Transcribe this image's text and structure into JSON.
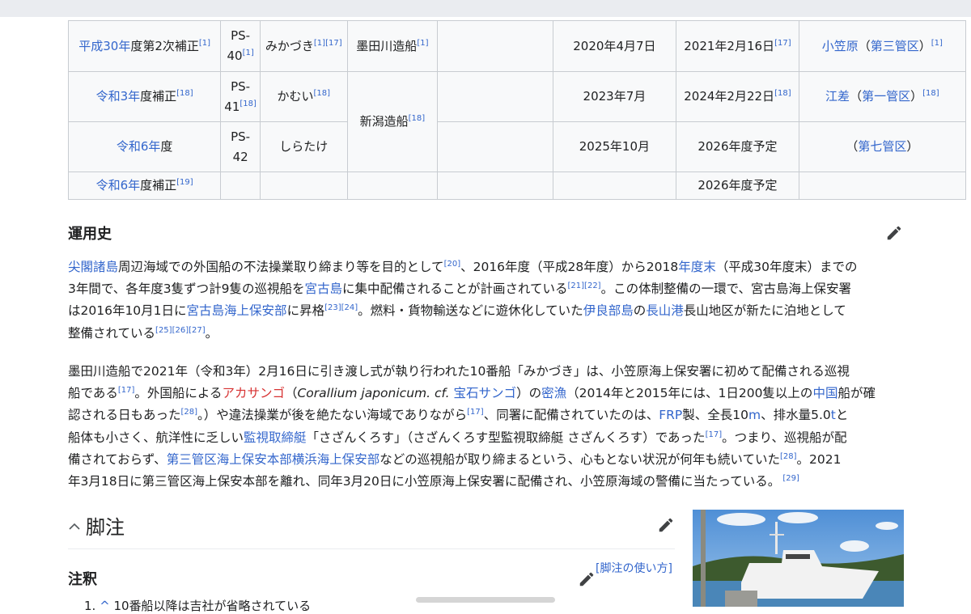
{
  "table": {
    "rows": [
      {
        "cells": [
          [
            {
              "k": "link",
              "t": "平成30年"
            },
            {
              "k": "text",
              "t": "度第2次補正"
            },
            {
              "k": "ref",
              "t": "[1]"
            }
          ],
          [
            {
              "k": "text",
              "t": "PS-"
            },
            {
              "k": "br"
            },
            {
              "k": "text",
              "t": "40"
            },
            {
              "k": "ref",
              "t": "[1]"
            }
          ],
          [
            {
              "k": "text",
              "t": "みかづき"
            },
            {
              "k": "ref",
              "t": "[1][17]"
            }
          ],
          [
            {
              "k": "text",
              "t": "墨田川造船"
            },
            {
              "k": "ref",
              "t": "[1]"
            }
          ],
          [],
          [
            {
              "k": "text",
              "t": "2020年4月7日"
            }
          ],
          [
            {
              "k": "text",
              "t": "2021年2月16日"
            },
            {
              "k": "ref",
              "t": "[17]"
            }
          ],
          [
            {
              "k": "link",
              "t": "小笠原"
            },
            {
              "k": "text",
              "t": "（"
            },
            {
              "k": "link",
              "t": "第三管区"
            },
            {
              "k": "text",
              "t": "）"
            },
            {
              "k": "ref",
              "t": "[1]"
            }
          ]
        ]
      },
      {
        "cells": [
          [
            {
              "k": "link",
              "t": "令和3年"
            },
            {
              "k": "text",
              "t": "度補正"
            },
            {
              "k": "ref",
              "t": "[18]"
            }
          ],
          [
            {
              "k": "text",
              "t": "PS-"
            },
            {
              "k": "br"
            },
            {
              "k": "text",
              "t": "41"
            },
            {
              "k": "ref",
              "t": "[18]"
            }
          ],
          [
            {
              "k": "text",
              "t": "かむい"
            },
            {
              "k": "ref",
              "t": "[18]"
            }
          ],
          [
            {
              "k": "text",
              "t": "新潟造船"
            },
            {
              "k": "ref",
              "t": "[18]"
            }
          ],
          [],
          [
            {
              "k": "text",
              "t": "2023年7月"
            }
          ],
          [
            {
              "k": "text",
              "t": "2024年2月22日"
            },
            {
              "k": "ref",
              "t": "[18]"
            }
          ],
          [
            {
              "k": "link",
              "t": "江差"
            },
            {
              "k": "text",
              "t": "（"
            },
            {
              "k": "link",
              "t": "第一管区"
            },
            {
              "k": "text",
              "t": "）"
            },
            {
              "k": "ref",
              "t": "[18]"
            }
          ]
        ]
      },
      {
        "cells": [
          [
            {
              "k": "link",
              "t": "令和6年"
            },
            {
              "k": "text",
              "t": "度"
            }
          ],
          [
            {
              "k": "text",
              "t": "PS-"
            },
            {
              "k": "br"
            },
            {
              "k": "text",
              "t": "42"
            }
          ],
          [
            {
              "k": "text",
              "t": "しらたけ"
            }
          ],
          [],
          [
            {
              "k": "text",
              "t": "2025年10月"
            }
          ],
          [
            {
              "k": "text",
              "t": "2026年度予定"
            }
          ],
          [
            {
              "k": "text",
              "t": "（"
            },
            {
              "k": "link",
              "t": "第七管区"
            },
            {
              "k": "text",
              "t": "）"
            }
          ]
        ]
      },
      {
        "cells": [
          [
            {
              "k": "link",
              "t": "令和6年"
            },
            {
              "k": "text",
              "t": "度補正"
            },
            {
              "k": "ref",
              "t": "[19]"
            }
          ],
          [],
          [],
          [],
          [],
          [],
          [
            {
              "k": "text",
              "t": "2026年度予定"
            }
          ],
          []
        ]
      }
    ]
  },
  "history": {
    "heading": "運用史",
    "paragraphs": [
      [
        {
          "k": "link",
          "t": "尖閣諸島"
        },
        {
          "k": "text",
          "t": "周辺海域での外国船の不法操業取り締まり等を目的として"
        },
        {
          "k": "ref",
          "t": "[20]"
        },
        {
          "k": "text",
          "t": "、2016年度（平成28年度）から2018"
        },
        {
          "k": "link",
          "t": "年度末"
        },
        {
          "k": "text",
          "t": "（平成30年度末）までの"
        },
        {
          "k": "br"
        },
        {
          "k": "text",
          "t": "3年間で、各年度3隻ずつ計9隻の巡視船を"
        },
        {
          "k": "link",
          "t": "宮古島"
        },
        {
          "k": "text",
          "t": "に集中配備されることが計画されている"
        },
        {
          "k": "ref",
          "t": "[21][22]"
        },
        {
          "k": "text",
          "t": "。この体制整備の一環で、宮古島海上保安署"
        },
        {
          "k": "br"
        },
        {
          "k": "text",
          "t": "は2016年10月1日に"
        },
        {
          "k": "link",
          "t": "宮古島海上保安部"
        },
        {
          "k": "text",
          "t": "に昇格"
        },
        {
          "k": "ref",
          "t": "[23][24]"
        },
        {
          "k": "text",
          "t": "。燃料・貨物輸送などに遊休化していた"
        },
        {
          "k": "link",
          "t": "伊良部島"
        },
        {
          "k": "text",
          "t": "の"
        },
        {
          "k": "link",
          "t": "長山港"
        },
        {
          "k": "text",
          "t": "長山地区が新たに泊地として"
        },
        {
          "k": "br"
        },
        {
          "k": "text",
          "t": "整備されている"
        },
        {
          "k": "ref",
          "t": "[25][26][27]"
        },
        {
          "k": "text",
          "t": "。"
        }
      ],
      [
        {
          "k": "text",
          "t": "墨田川造船で2021年（令和3年）2月16日に引き渡し式が執り行われた10番船「みかづき」は、小笠原海上保安署に初めて配備される巡視"
        },
        {
          "k": "br"
        },
        {
          "k": "text",
          "t": "船である"
        },
        {
          "k": "ref",
          "t": "[17]"
        },
        {
          "k": "text",
          "t": "。外国船による"
        },
        {
          "k": "red",
          "t": "アカサンゴ"
        },
        {
          "k": "text",
          "t": "（"
        },
        {
          "k": "italic",
          "t": "Corallium japonicum. cf."
        },
        {
          "k": "text",
          "t": " "
        },
        {
          "k": "link",
          "t": "宝石サンゴ"
        },
        {
          "k": "text",
          "t": "）の"
        },
        {
          "k": "link",
          "t": "密漁"
        },
        {
          "k": "text",
          "t": "（2014年と2015年には、1日200隻以上の"
        },
        {
          "k": "link",
          "t": "中国"
        },
        {
          "k": "text",
          "t": "船が確"
        },
        {
          "k": "br"
        },
        {
          "k": "text",
          "t": "認される日もあった"
        },
        {
          "k": "ref",
          "t": "[28]"
        },
        {
          "k": "text",
          "t": "。）や違法操業が後を絶たない海域でありながら"
        },
        {
          "k": "ref",
          "t": "[17]"
        },
        {
          "k": "text",
          "t": "、同署に配備されていたのは、"
        },
        {
          "k": "link",
          "t": "FRP"
        },
        {
          "k": "text",
          "t": "製、全長10"
        },
        {
          "k": "link",
          "t": "m"
        },
        {
          "k": "text",
          "t": "、排水量5.0"
        },
        {
          "k": "link",
          "t": "t"
        },
        {
          "k": "text",
          "t": "と"
        },
        {
          "k": "br"
        },
        {
          "k": "text",
          "t": "船体も小さく、航洋性に乏しい"
        },
        {
          "k": "link",
          "t": "監視取締艇"
        },
        {
          "k": "text",
          "t": "「さざんくろす」（さざんくろす型監視取締艇 さざんくろす）であった"
        },
        {
          "k": "ref",
          "t": "[17]"
        },
        {
          "k": "text",
          "t": "。つまり、巡視船が配"
        },
        {
          "k": "br"
        },
        {
          "k": "text",
          "t": "備されておらず、"
        },
        {
          "k": "link",
          "t": "第三管区海上保安本部横浜海上保安部"
        },
        {
          "k": "text",
          "t": "などの巡視船が取り締まるという、心もとない状況が何年も続いていた"
        },
        {
          "k": "ref",
          "t": "[28]"
        },
        {
          "k": "text",
          "t": "。2021"
        },
        {
          "k": "br"
        },
        {
          "k": "text",
          "t": "年3月18日に第三管区海上保安本部を離れ、同年3月20日に小笠原海上保安署に配備され、小笠原海域の警備に当たっている。"
        },
        {
          "k": "ref",
          "t": " [29]"
        }
      ]
    ]
  },
  "footnotes": {
    "heading": "脚注",
    "notes_heading": "注釈",
    "howto_link": "[脚注の使い方]",
    "first_item_num": "1.",
    "first_item_caret": "^",
    "first_item_text": "10番船以降は吉社が省略されている"
  },
  "colors": {
    "link": "#3366cc",
    "redlink": "#d73333",
    "cell_bg": "#f8f9fa"
  }
}
